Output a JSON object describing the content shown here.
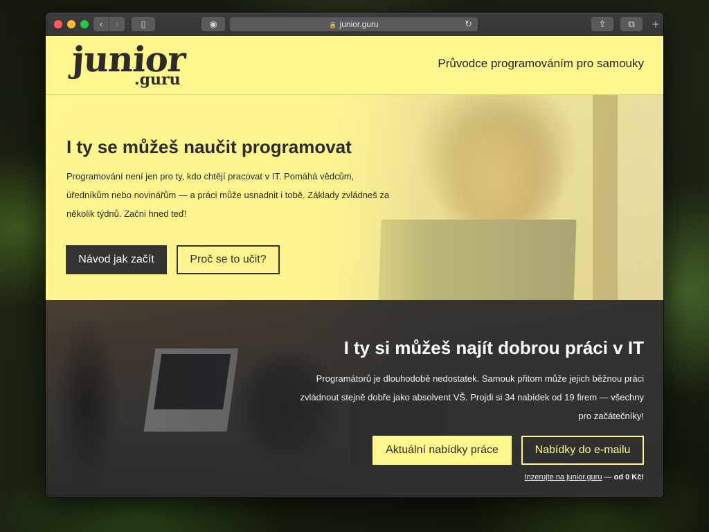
{
  "browser": {
    "url": "junior.guru",
    "back_glyph": "‹",
    "forward_glyph": "›",
    "sidebar_glyph": "▯",
    "privacy_glyph": "◉",
    "share_glyph": "⇪",
    "tabs_glyph": "⧉",
    "new_tab_glyph": "+",
    "lock_glyph": "🔒",
    "reload_glyph": "↻"
  },
  "header": {
    "logo_main": "junior",
    "logo_sub": ".guru",
    "tagline": "Průvodce programováním pro samouky"
  },
  "hero_learn": {
    "title": "I ty se můžeš naučit programovat",
    "text": "Programování není jen pro ty, kdo chtějí pracovat v IT. Pomáhá vědcům, úředníkům nebo novinářům — a práci může usnadnit i tobě. Základy zvládneš za několik týdnů. Začni hned teď!",
    "primary_button": "Návod jak začít",
    "secondary_button": "Proč se to učit?"
  },
  "hero_jobs": {
    "title": "I ty si můžeš najít dobrou práci v IT",
    "text": "Programátorů je dlouhodobě nedostatek. Samouk přitom může jejich běžnou práci zvládnout stejně dobře jako absolvent VŠ. Projdi si 34 nabídek od 19 firem — všechny pro začátečníky!",
    "primary_button": "Aktuální nabídky práce",
    "secondary_button": "Nabídky do e-mailu",
    "ad_link": "Inzerujte na junior.guru",
    "ad_dash": " — ",
    "ad_price": "od 0 Kč!"
  },
  "colors": {
    "brand_yellow": "#fff68e",
    "dark": "#333333"
  }
}
